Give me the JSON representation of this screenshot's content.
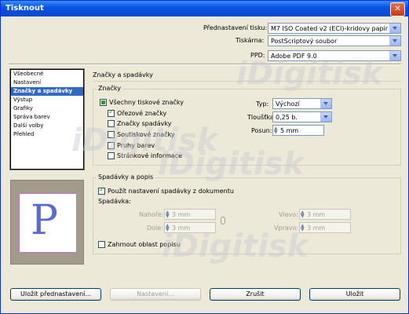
{
  "window": {
    "title": "Tisknout"
  },
  "header": {
    "preset_label": "Přednastavení tisku:",
    "preset_value": "M7 ISO Coated v2 (ECI)-kridovy papir",
    "printer_label": "Tiskárna:",
    "printer_value": "PostScriptový soubor",
    "ppd_label": "PPD:",
    "ppd_value": "Adobe PDF 9.0"
  },
  "sidebar": {
    "items": [
      {
        "label": "Všeobecné"
      },
      {
        "label": "Nastavení"
      },
      {
        "label": "Značky a spadávky"
      },
      {
        "label": "Výstup"
      },
      {
        "label": "Grafiky"
      },
      {
        "label": "Správa barev"
      },
      {
        "label": "Další volby"
      },
      {
        "label": "Přehled"
      }
    ],
    "selected_index": 2
  },
  "preview": {
    "letter": "P"
  },
  "section_title": "Značky a spadávky",
  "marks": {
    "group_title": "Značky",
    "all_label": "Všechny tiskové značky",
    "crop_label": "Ořezové značky",
    "bleed_label": "Značky spadávky",
    "reg_label": "Soutiskové značky",
    "color_bars_label": "Pruhy barev",
    "page_info_label": "Stránkové informace",
    "type_label": "Typ:",
    "type_value": "Výchozí",
    "weight_label": "Tloušťka:",
    "weight_value": "0,25 b.",
    "offset_label": "Posun:",
    "offset_value": "5 mm"
  },
  "bleed": {
    "group_title": "Spadávky a popis",
    "use_doc_label": "Použít nastavení spadávky z dokumentu",
    "bleed_label": "Spadávka:",
    "top_label": "Nahoře:",
    "top_value": "3 mm",
    "bottom_label": "Dole:",
    "bottom_value": "3 mm",
    "left_label": "Vlevo:",
    "left_value": "3 mm",
    "right_label": "Vpravo:",
    "right_value": "3 mm",
    "slug_label": "Zahrnout oblast popisu"
  },
  "buttons": {
    "save_preset": "Uložit přednastavení...",
    "setup": "Nastavení...",
    "cancel": "Zrušit",
    "save": "Uložit"
  },
  "watermark": {
    "text": "iDigitisk"
  }
}
